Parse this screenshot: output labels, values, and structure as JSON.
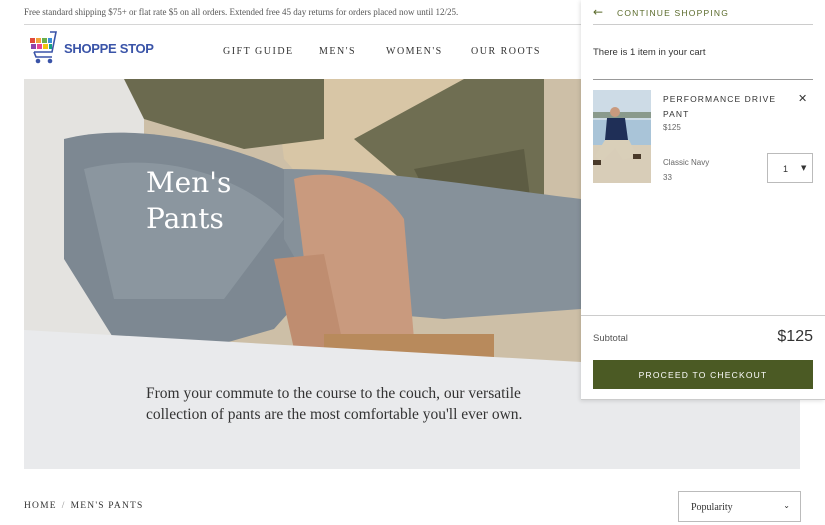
{
  "promo": {
    "text": "Free standard shipping $75+ or flat rate $5 on all orders. Extended free 45 day returns for orders placed now until 12/25."
  },
  "header": {
    "logo_text": "SHOPPE STOP",
    "nav": [
      "GIFT GUIDE",
      "MEN'S",
      "WOMEN'S",
      "OUR ROOTS"
    ]
  },
  "hero": {
    "title_line1": "Men's",
    "title_line2": "Pants",
    "intro": "From your commute to the course to the couch, our versatile collection of pants are the most comfortable you'll ever own."
  },
  "breadcrumb": {
    "home": "HOME",
    "separator": "/",
    "current": "MEN'S PANTS"
  },
  "sort": {
    "selected": "Popularity"
  },
  "cart": {
    "back_label": "CONTINUE SHOPPING",
    "count_text": "There is 1 item in your cart",
    "item": {
      "name": "PERFORMANCE DRIVE PANT",
      "price": "$125",
      "color": "Classic Navy",
      "size": "33",
      "quantity": "1"
    },
    "subtotal_label": "Subtotal",
    "subtotal_value": "$125",
    "checkout_label": "PROCEED TO CHECKOUT"
  },
  "colors": {
    "accent_green": "#4b5a24",
    "link_green": "#5a6a2a",
    "logo_blue": "#3a54a8",
    "band_gray": "#e9eaec"
  },
  "icons": [
    "cart-logo-icon",
    "arrow-left-icon",
    "close-icon",
    "chevron-down-icon"
  ]
}
